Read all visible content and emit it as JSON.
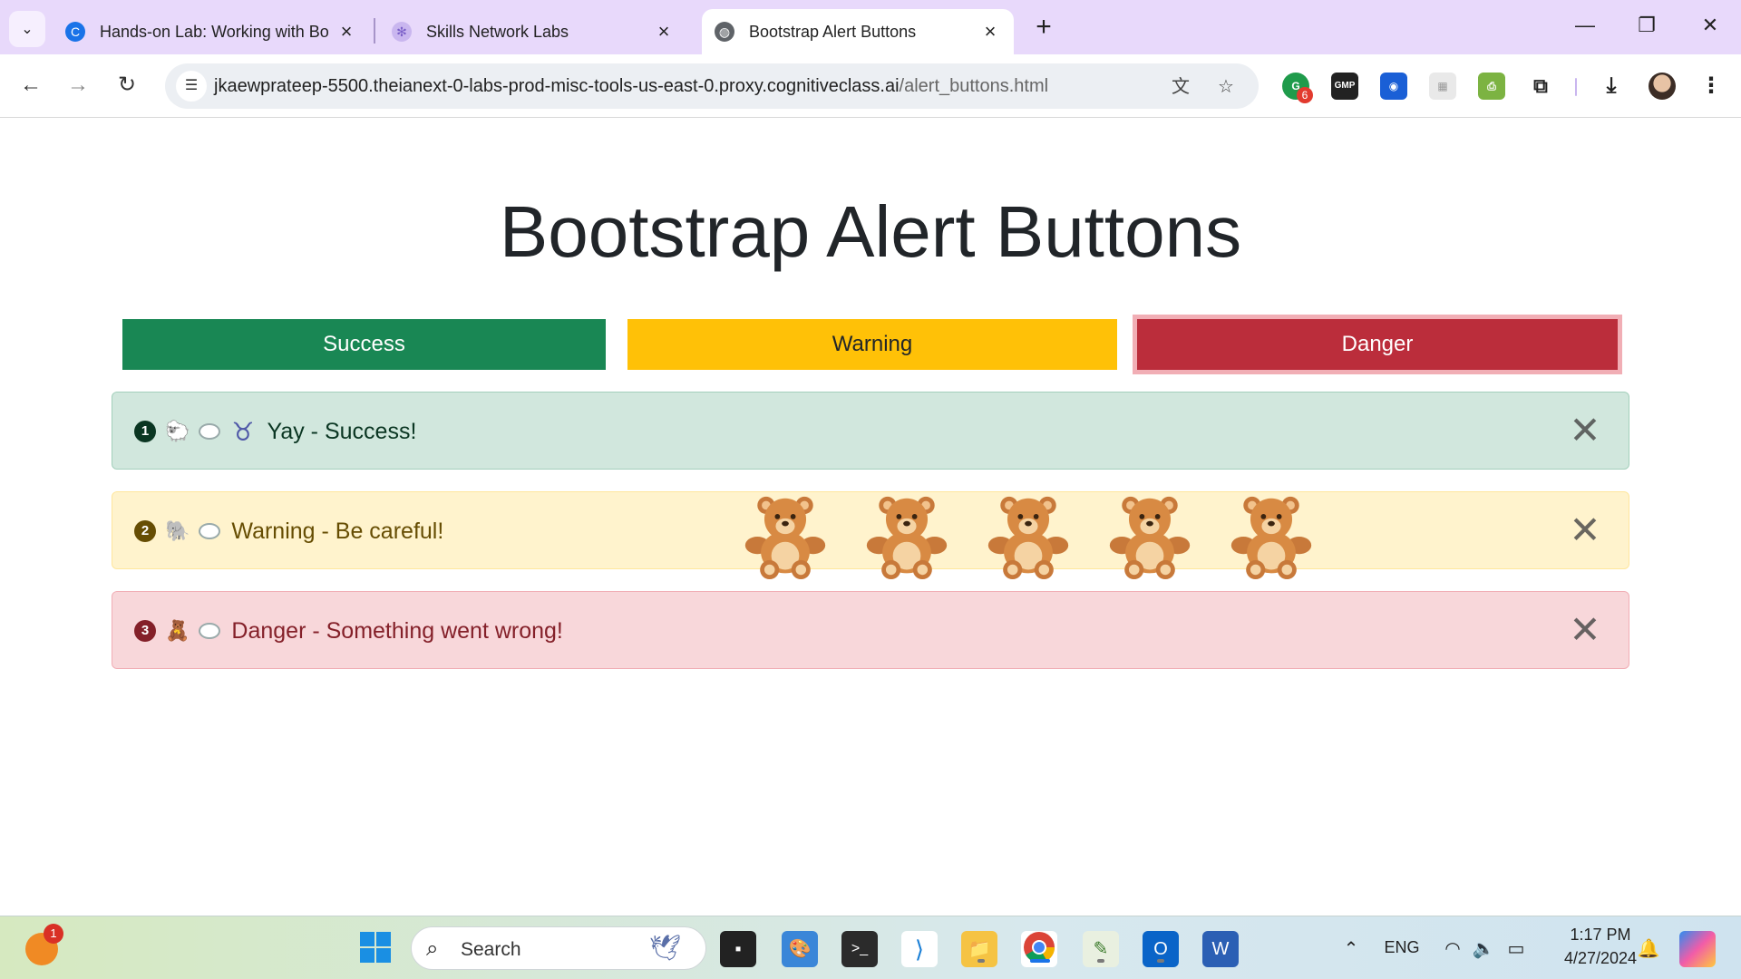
{
  "browser": {
    "tabs": [
      {
        "title": "Hands-on Lab: Working with Bo",
        "active": false
      },
      {
        "title": "Skills Network Labs",
        "active": false
      },
      {
        "title": "Bootstrap Alert Buttons",
        "active": true
      }
    ],
    "url_host": "jkaewprateep-5500.theianext-0-labs-prod-misc-tools-us-east-0.proxy.cognitiveclass.ai",
    "url_path": "/alert_buttons.html",
    "extension_badge": "6",
    "gmp_label": "GMP"
  },
  "page": {
    "title": "Bootstrap Alert Buttons",
    "buttons": {
      "success": "Success",
      "warning": "Warning",
      "danger": "Danger"
    },
    "alerts": [
      {
        "number": "1",
        "emoji": "🐑",
        "message": "Yay - Success!"
      },
      {
        "number": "2",
        "emoji": "🐘",
        "message": "Warning - Be careful!"
      },
      {
        "number": "3",
        "emoji": "🧸",
        "message": "Danger - Something went wrong!"
      }
    ],
    "teddy_bear_count": 5
  },
  "taskbar": {
    "search_placeholder": "Search",
    "notification_badge": "1",
    "language": "ENG",
    "time": "1:17 PM",
    "date": "4/27/2024"
  },
  "colors": {
    "success": "#198754",
    "warning": "#ffc107",
    "danger": "#bb2d3b",
    "tabbar": "#e8d9fb"
  }
}
